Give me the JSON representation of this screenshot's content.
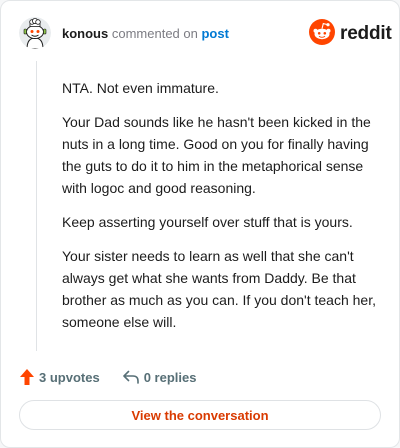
{
  "header": {
    "username": "konous",
    "action_text": "commented on",
    "post_link": "post",
    "avatar_icon": "snoo-avatar-icon",
    "logo_icon": "reddit-logo-icon",
    "logo_text": "reddit"
  },
  "comment": {
    "paragraphs": [
      "NTA. Not even immature.",
      "Your Dad sounds like he hasn't been kicked in the nuts in a long time. Good on you for finally having the guts to do it to him in the metaphorical sense with logoc and good reasoning.",
      "Keep asserting yourself over stuff that is yours.",
      "Your sister needs to learn as well that she can't always get what she wants from Daddy. Be that brother as much as you can. If you don't teach her, someone else will."
    ]
  },
  "actions": {
    "upvotes": "3 upvotes",
    "upvote_icon": "upvote-arrow-icon",
    "replies": "0 replies",
    "reply_icon": "reply-arrow-icon"
  },
  "cta": {
    "label": "View the conversation"
  },
  "colors": {
    "brand": "#ff4500",
    "link": "#0079d3",
    "cta_text": "#d93a00",
    "meta_text": "#576f76"
  }
}
